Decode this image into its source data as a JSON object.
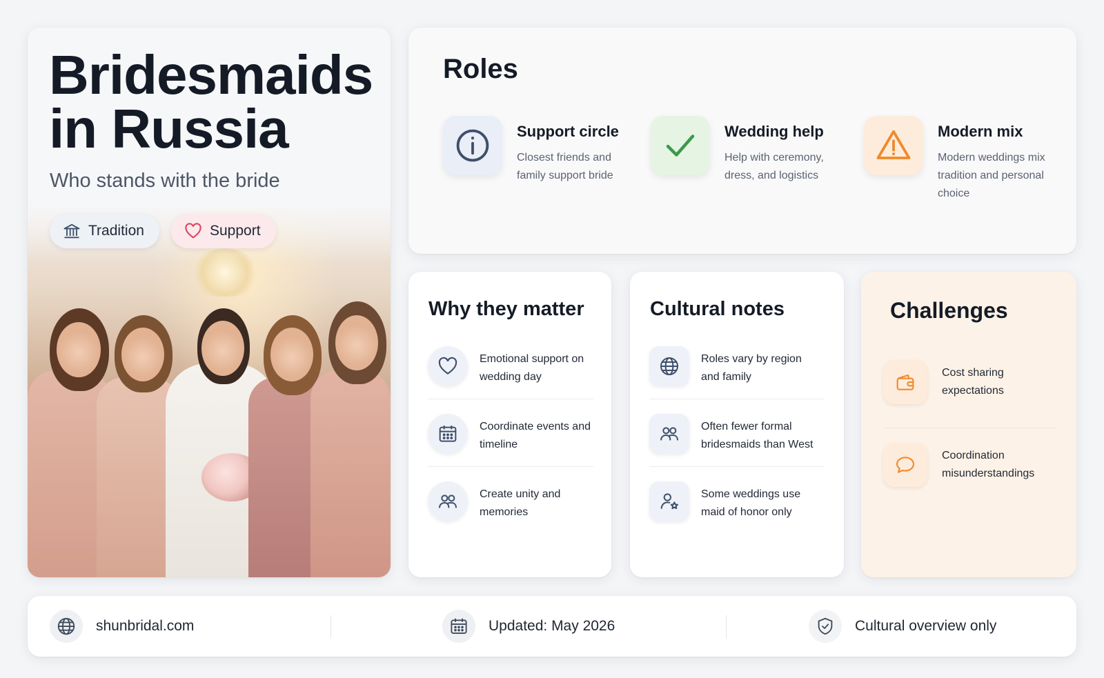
{
  "hero": {
    "title_line1": "Bridesmaids",
    "title_line2": "in Russia",
    "subtitle": "Who stands with the bride",
    "chips": [
      {
        "label": "Tradition",
        "icon": "museum-icon"
      },
      {
        "label": "Support",
        "icon": "heart-icon"
      }
    ]
  },
  "roles": {
    "title": "Roles",
    "items": [
      {
        "title": "Support circle",
        "desc": "Closest friends and family support bride",
        "icon": "info-icon",
        "color": "#3f4f6b"
      },
      {
        "title": "Wedding help",
        "desc": "Help with ceremony, dress, and logistics",
        "icon": "check-icon",
        "color": "#3b9a4a"
      },
      {
        "title": "Modern mix",
        "desc": "Modern weddings mix tradition and personal choice",
        "icon": "warning-icon",
        "color": "#f08a2c"
      }
    ]
  },
  "why": {
    "title": "Why they matter",
    "items": [
      {
        "text": "Emotional support on wedding day",
        "icon": "heart-icon"
      },
      {
        "text": "Coordinate events and timeline",
        "icon": "calendar-icon"
      },
      {
        "text": "Create unity and memories",
        "icon": "users-icon"
      }
    ]
  },
  "notes": {
    "title": "Cultural notes",
    "items": [
      {
        "text": "Roles vary by region and family",
        "icon": "globe-icon"
      },
      {
        "text": "Often fewer formal bridesmaids than West",
        "icon": "users-icon"
      },
      {
        "text": "Some weddings use maid of honor only",
        "icon": "user-star-icon"
      }
    ]
  },
  "challenges": {
    "title": "Challenges",
    "items": [
      {
        "text": "Cost sharing expectations",
        "icon": "wallet-icon"
      },
      {
        "text": "Coordination misunderstandings",
        "icon": "chat-icon"
      }
    ]
  },
  "footer": {
    "site": "shunbridal.com",
    "updated": "Updated: May 2026",
    "disclaimer": "Cultural overview only"
  },
  "colors": {
    "accent_blue": "#3f4f6b",
    "accent_green": "#3b9a4a",
    "accent_orange": "#f08a2c",
    "accent_pink": "#d7475f"
  }
}
